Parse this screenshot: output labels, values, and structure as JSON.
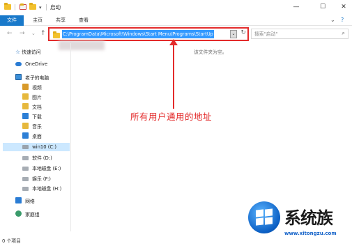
{
  "window": {
    "title": "启动",
    "quick_access_divider": "|",
    "pin": "▾",
    "controls": {
      "minimize": "—",
      "maximize": "☐",
      "close": "✕"
    }
  },
  "ribbon": {
    "tabs": [
      "文件",
      "主页",
      "共享",
      "查看"
    ],
    "expand": "⌄",
    "help": "?"
  },
  "nav": {
    "back": "←",
    "forward": "→",
    "recent": "⌄",
    "up": "↑"
  },
  "address": {
    "path": "C:\\ProgramData\\Microsoft\\Windows\\Start Menu\\Programs\\StartUp",
    "dropdown": "⌄",
    "refresh": "↻"
  },
  "search": {
    "placeholder": "搜索\"启动\"",
    "icon": "⌕"
  },
  "sidebar": {
    "items": [
      {
        "label": "快速访问",
        "icon": "star-icon"
      },
      {
        "label": "OneDrive",
        "icon": "cloud-icon"
      },
      {
        "label": "老子的电脑",
        "icon": "computer-icon"
      },
      {
        "label": "视频",
        "icon": "video-folder-icon"
      },
      {
        "label": "图片",
        "icon": "pictures-folder-icon"
      },
      {
        "label": "文档",
        "icon": "documents-folder-icon"
      },
      {
        "label": "下载",
        "icon": "downloads-folder-icon"
      },
      {
        "label": "音乐",
        "icon": "music-folder-icon"
      },
      {
        "label": "桌面",
        "icon": "desktop-folder-icon"
      },
      {
        "label": "win10 (C:)",
        "icon": "system-drive-icon"
      },
      {
        "label": "软件 (D:)",
        "icon": "drive-icon"
      },
      {
        "label": "本地磁盘 (E:)",
        "icon": "drive-icon"
      },
      {
        "label": "娱乐 (F:)",
        "icon": "drive-icon"
      },
      {
        "label": "本地磁盘 (H:)",
        "icon": "drive-icon"
      },
      {
        "label": "网络",
        "icon": "network-icon"
      },
      {
        "label": "家庭组",
        "icon": "homegroup-icon"
      }
    ]
  },
  "main": {
    "empty_message": "该文件夹为空。"
  },
  "annotation": {
    "text": "所有用户通用的地址"
  },
  "status_bar": {
    "items": "0 个项目"
  },
  "watermark": {
    "brand": "系统族",
    "url": "www.xitongzu.com"
  },
  "colors": {
    "accent": "#1979ca",
    "highlight_border": "#e32b2b",
    "selection": "#3399ff",
    "annotation": "#e32b2b"
  }
}
